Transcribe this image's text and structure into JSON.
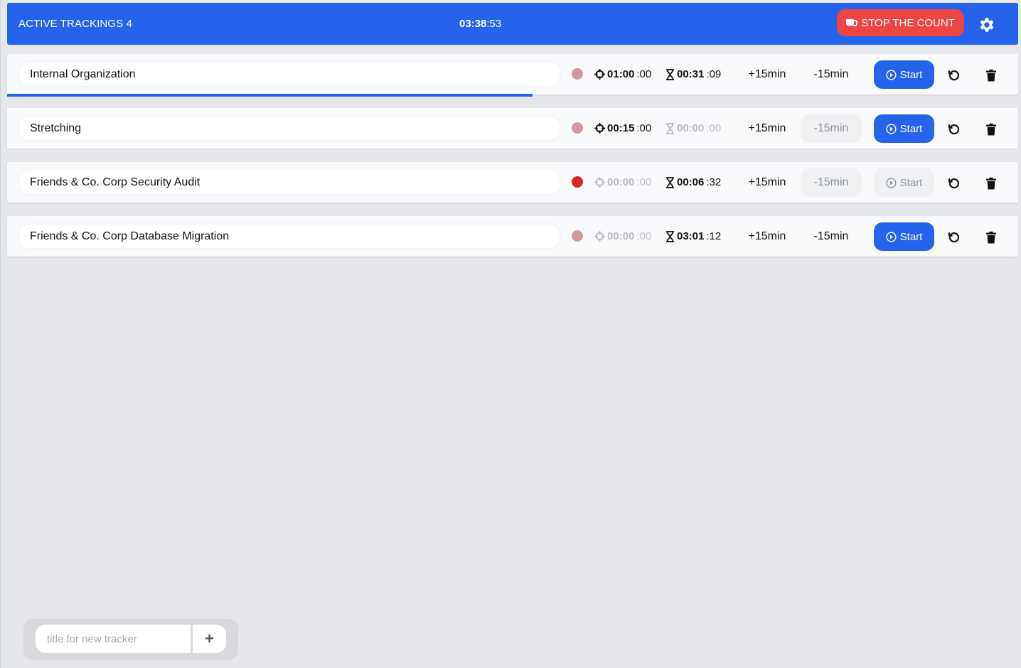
{
  "header": {
    "label": "ACTIVE TRACKINGS 4",
    "total_bold": "03:38",
    "total_rest": ":53",
    "stop_label": "STOP THE COUNT",
    "color": "#2563eb"
  },
  "trackers": [
    {
      "title": "Internal Organization",
      "status_color": "#cd9b9d",
      "target_main": "01:00",
      "target_sec": " :00",
      "target_dim": false,
      "elapsed_main": "00:31",
      "elapsed_sec": " :09",
      "elapsed_dim": false,
      "plus": "+15min",
      "minus": "-15min",
      "minus_disabled": false,
      "start": "Start",
      "start_disabled": false,
      "progress": 0.52
    },
    {
      "title": "Stretching",
      "status_color": "#cd9b9d",
      "target_main": "00:15",
      "target_sec": " :00",
      "target_dim": false,
      "elapsed_main": "00:00",
      "elapsed_sec": " :00",
      "elapsed_dim": true,
      "plus": "+15min",
      "minus": "-15min",
      "minus_disabled": true,
      "start": "Start",
      "start_disabled": false,
      "progress": 0
    },
    {
      "title": "Friends & Co. Corp Security Audit",
      "status_color": "#dc2626",
      "target_main": "00:00",
      "target_sec": " :00",
      "target_dim": true,
      "elapsed_main": "00:06",
      "elapsed_sec": " :32",
      "elapsed_dim": false,
      "plus": "+15min",
      "minus": "-15min",
      "minus_disabled": true,
      "start": "Start",
      "start_disabled": true,
      "progress": 0
    },
    {
      "title": "Friends & Co. Corp Database Migration",
      "status_color": "#cd9b9d",
      "target_main": "00:00",
      "target_sec": " :00",
      "target_dim": true,
      "elapsed_main": "03:01",
      "elapsed_sec": " :12",
      "elapsed_dim": false,
      "plus": "+15min",
      "minus": "-15min",
      "minus_disabled": false,
      "start": "Start",
      "start_disabled": false,
      "progress": 0
    }
  ],
  "new_tracker": {
    "placeholder": "title for new tracker",
    "add_label": "+"
  }
}
